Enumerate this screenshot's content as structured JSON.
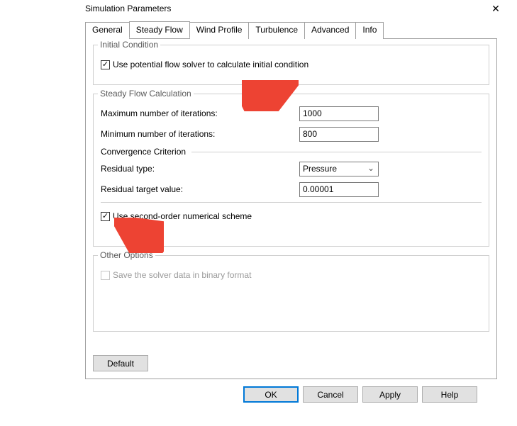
{
  "window": {
    "title": "Simulation Parameters"
  },
  "tabs": [
    {
      "label": "General"
    },
    {
      "label": "Steady Flow"
    },
    {
      "label": "Wind Profile"
    },
    {
      "label": "Turbulence"
    },
    {
      "label": "Advanced"
    },
    {
      "label": "Info"
    }
  ],
  "groups": {
    "initial": {
      "title": "Initial Condition",
      "use_potential_label": "Use potential flow solver to calculate initial condition",
      "use_potential_checked": true
    },
    "steady": {
      "title": "Steady Flow Calculation",
      "max_iter_label": "Maximum number of iterations:",
      "max_iter_value": "1000",
      "min_iter_label": "Minimum number of iterations:",
      "min_iter_value": "800",
      "conv_label": "Convergence Criterion",
      "residual_type_label": "Residual type:",
      "residual_type_value": "Pressure",
      "residual_target_label": "Residual target value:",
      "residual_target_value": "0.00001",
      "second_order_label": "Use second-order numerical scheme",
      "second_order_checked": true
    },
    "other": {
      "title": "Other Options",
      "save_binary_label": "Save the solver data in binary format",
      "save_binary_checked": false,
      "save_binary_enabled": false
    }
  },
  "buttons": {
    "default": "Default",
    "ok": "OK",
    "cancel": "Cancel",
    "apply": "Apply",
    "help": "Help"
  },
  "annotations": {
    "arrow_color": "#ed4333"
  }
}
